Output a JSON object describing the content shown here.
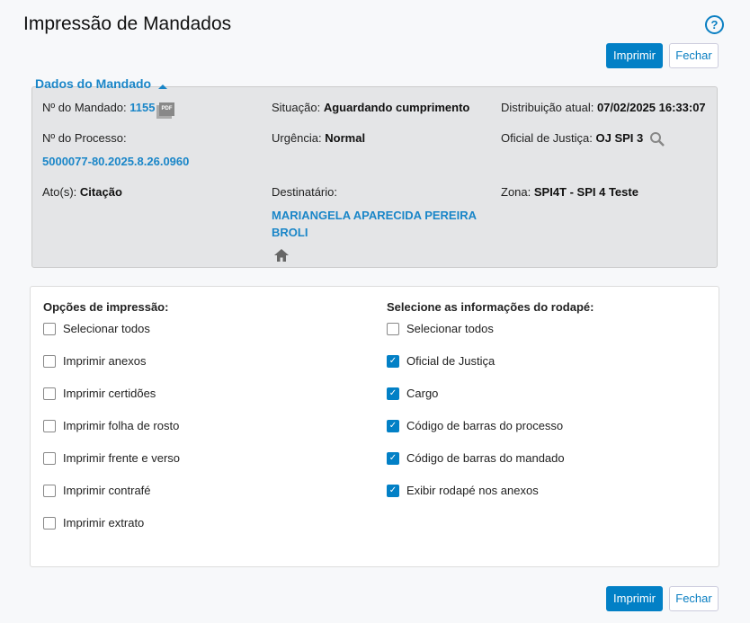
{
  "title": "Impressão de Mandados",
  "buttons": {
    "print": "Imprimir",
    "close": "Fechar"
  },
  "section": "Dados do Mandado",
  "fields": {
    "mandado_label": "Nº do Mandado:",
    "mandado_value": "1155",
    "situacao_label": "Situação:",
    "situacao_value": "Aguardando cumprimento",
    "distrib_label": "Distribuição atual:",
    "distrib_value": "07/02/2025 16:33:07",
    "processo_label": "Nº do Processo:",
    "processo_value": "5000077-80.2025.8.26.0960",
    "urgencia_label": "Urgência:",
    "urgencia_value": "Normal",
    "oficial_label": "Oficial de Justiça:",
    "oficial_value": "OJ SPI 3",
    "atos_label": "Ato(s):",
    "atos_value": "Citação",
    "destinatario_label": "Destinatário:",
    "destinatario_line1": "MARIANGELA APARECIDA PEREIRA",
    "destinatario_line2": "BROLI",
    "zona_label": "Zona:",
    "zona_value": "SPI4T - SPI 4 Teste"
  },
  "print_options": {
    "heading": "Opções de impressão:",
    "items": [
      {
        "label": "Selecionar todos",
        "checked": false
      },
      {
        "label": "Imprimir anexos",
        "checked": false
      },
      {
        "label": "Imprimir certidões",
        "checked": false
      },
      {
        "label": "Imprimir folha de rosto",
        "checked": false
      },
      {
        "label": "Imprimir frente e verso",
        "checked": false
      },
      {
        "label": "Imprimir contrafé",
        "checked": false
      },
      {
        "label": "Imprimir extrato",
        "checked": false
      }
    ]
  },
  "footer_options": {
    "heading": "Selecione as informações do rodapé:",
    "items": [
      {
        "label": "Selecionar todos",
        "checked": false
      },
      {
        "label": "Oficial de Justiça",
        "checked": true
      },
      {
        "label": "Cargo",
        "checked": true
      },
      {
        "label": "Código de barras do processo",
        "checked": true
      },
      {
        "label": "Código de barras do mandado",
        "checked": true
      },
      {
        "label": "Exibir rodapé nos anexos",
        "checked": true
      }
    ]
  }
}
